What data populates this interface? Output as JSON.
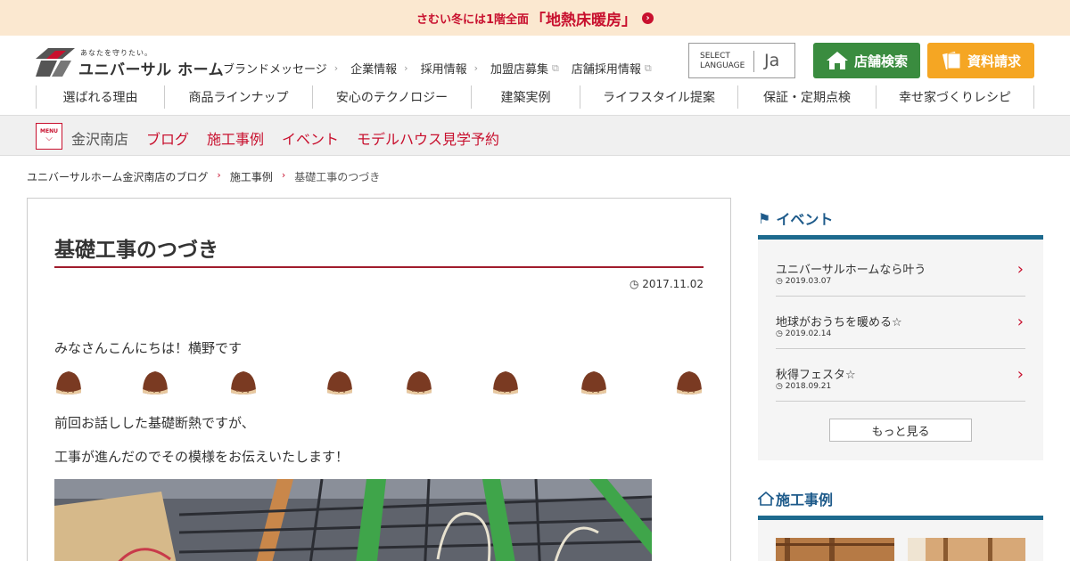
{
  "banner": {
    "text_small": "さむい冬には1階全面",
    "text_big": "「地熱床暖房」",
    "arrow_glyph": "›"
  },
  "header": {
    "logo": {
      "tagline": "あなたを守りたい。",
      "name": "ユニバーサル ホーム"
    },
    "top_nav": [
      {
        "label": "ブランドメッセージ",
        "external": false
      },
      {
        "label": "企業情報",
        "external": false
      },
      {
        "label": "採用情報",
        "external": false
      },
      {
        "label": "加盟店募集",
        "external": true
      },
      {
        "label": "店舗採用情報",
        "external": true
      }
    ],
    "language": {
      "label_line1": "SELECT",
      "label_line2": "LANGUAGE",
      "current": "Ja"
    },
    "store_search_label": "店舗検索",
    "doc_request_label": "資料請求",
    "main_nav": [
      {
        "label": "選ばれる理由"
      },
      {
        "label": "商品ラインナップ"
      },
      {
        "label": "安心のテクノロジー"
      },
      {
        "label": "建築実例"
      },
      {
        "label": "ライフスタイル提案"
      },
      {
        "label": "保証・定期点検"
      },
      {
        "label": "幸せ家づくりレシピ"
      }
    ]
  },
  "store_bar": {
    "menu_label": "MENU",
    "store_name": "金沢南店",
    "links": [
      "ブログ",
      "施工事例",
      "イベント",
      "モデルハウス見学予約"
    ]
  },
  "breadcrumb": {
    "items": [
      "ユニバーサルホーム金沢南店のブログ",
      "施工事例",
      "基礎工事のつづき"
    ]
  },
  "article": {
    "title": "基礎工事のつづき",
    "date": "2017.11.02",
    "paragraph1": "みなさんこんにちは！横野です",
    "paragraph2": "前回お話しした基礎断熱ですが、",
    "paragraph3": "工事が進んだのでその模様をお伝えいたします！"
  },
  "sidebar": {
    "events_heading": "イベント",
    "events": [
      {
        "title": "ユニバーサルホームなら叶う",
        "date": "2019.03.07"
      },
      {
        "title": "地球がおうちを暖める☆",
        "date": "2019.02.14"
      },
      {
        "title": "秋得フェスタ☆",
        "date": "2018.09.21"
      }
    ],
    "more_label": "もっと見る",
    "works_heading": "施工事例"
  },
  "colors": {
    "brand_red": "#c8102e",
    "green": "#3a8c3f",
    "orange": "#f5a623",
    "sidebar_blue": "#1d6a8e"
  }
}
